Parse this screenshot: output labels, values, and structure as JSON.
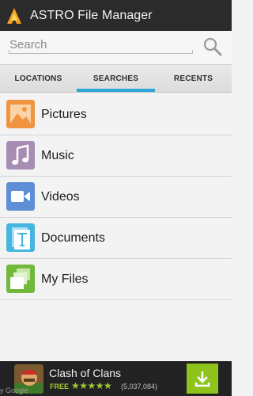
{
  "app": {
    "title": "ASTRO File Manager"
  },
  "search": {
    "placeholder": "Search"
  },
  "tabs": [
    {
      "label": "LOCATIONS"
    },
    {
      "label": "SEARCHES",
      "selected": true
    },
    {
      "label": "RECENTS"
    }
  ],
  "searches": [
    {
      "label": "Pictures",
      "icon": "pictures-icon",
      "color": "#f0943f"
    },
    {
      "label": "Music",
      "icon": "music-icon",
      "color": "#a78db3"
    },
    {
      "label": "Videos",
      "icon": "videos-icon",
      "color": "#5e8ed6"
    },
    {
      "label": "Documents",
      "icon": "documents-icon",
      "color": "#45b6e0"
    },
    {
      "label": "My Files",
      "icon": "my-files-icon",
      "color": "#71b83b"
    }
  ],
  "ad": {
    "app_name": "Clash of Clans",
    "price": "FREE",
    "rating_stars": "★★★★★",
    "rating_count": "(5,037,084)",
    "brand_text": "y Google"
  },
  "colors": {
    "accent": "#2aa7d8",
    "action_bar": "#2b2b2b",
    "ad_green": "#8ec31c"
  }
}
